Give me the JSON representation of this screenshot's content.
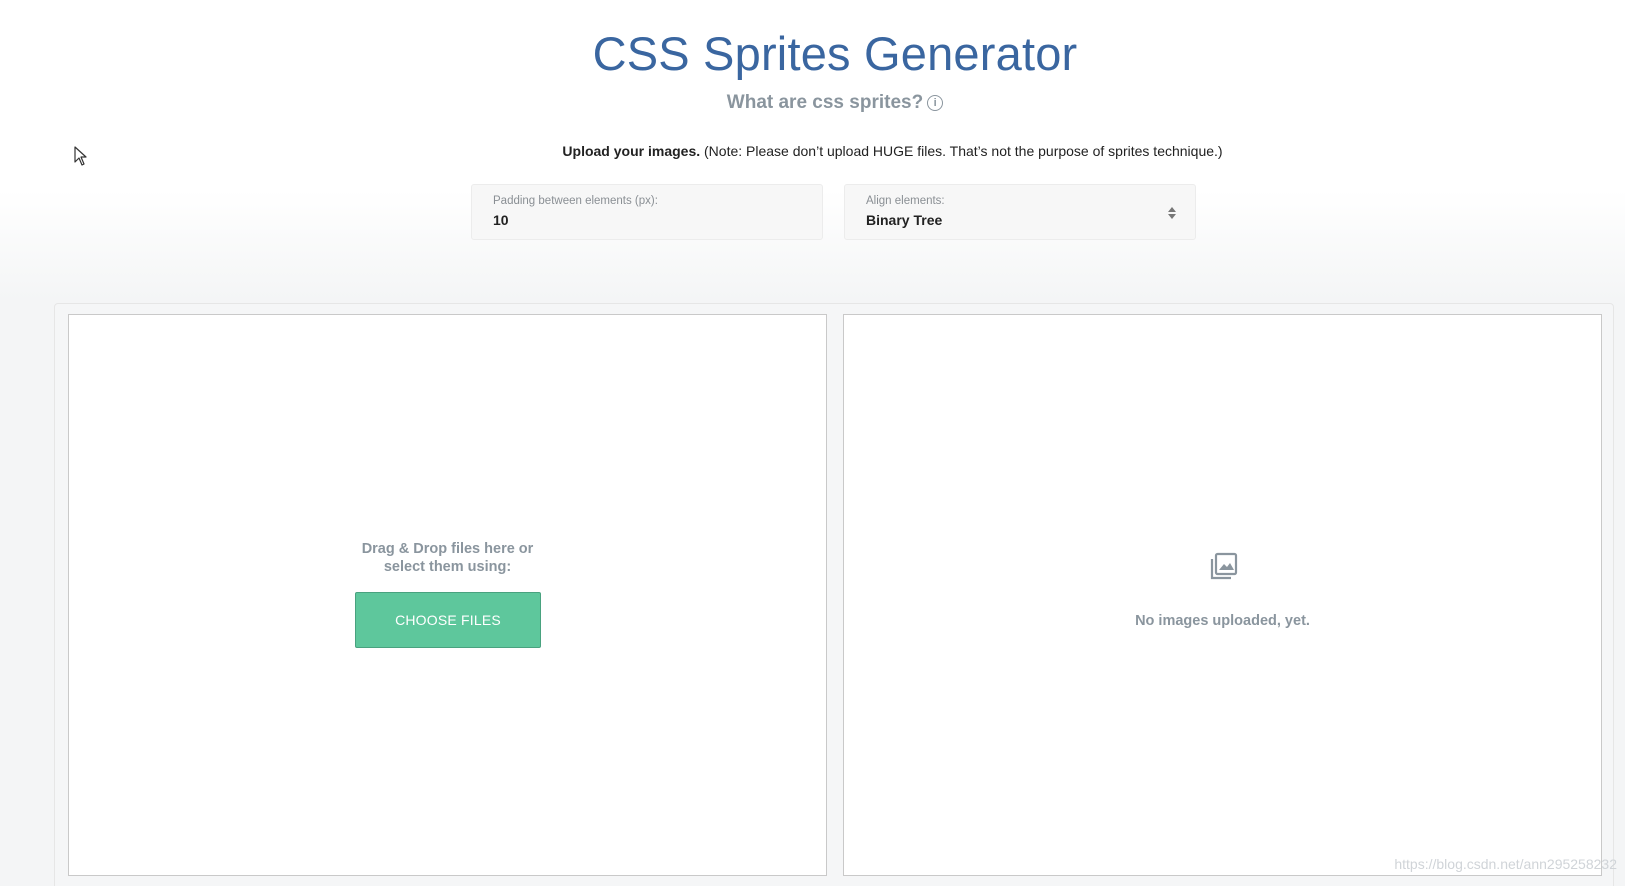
{
  "header": {
    "title": "CSS Sprites Generator",
    "subtitle": "What are css sprites?",
    "info_icon_glyph": "i",
    "note_bold": "Upload your images.",
    "note_rest": " (Note: Please don’t upload HUGE files. That’s not the purpose of sprites technique.)"
  },
  "settings": {
    "padding_label": "Padding between elements (px):",
    "padding_value": "10",
    "align_label": "Align elements:",
    "align_value": "Binary Tree"
  },
  "upload_panel": {
    "drop_line1": "Drag & Drop files here or",
    "drop_line2": "select them using:",
    "choose_button": "CHOOSE FILES"
  },
  "preview_panel": {
    "icon": "images-icon",
    "empty_message": "No images uploaded, yet."
  },
  "watermark": "https://blog.csdn.net/ann295258232",
  "colors": {
    "title": "#3a66a0",
    "muted": "#8a959e",
    "button": "#5ec79c"
  }
}
